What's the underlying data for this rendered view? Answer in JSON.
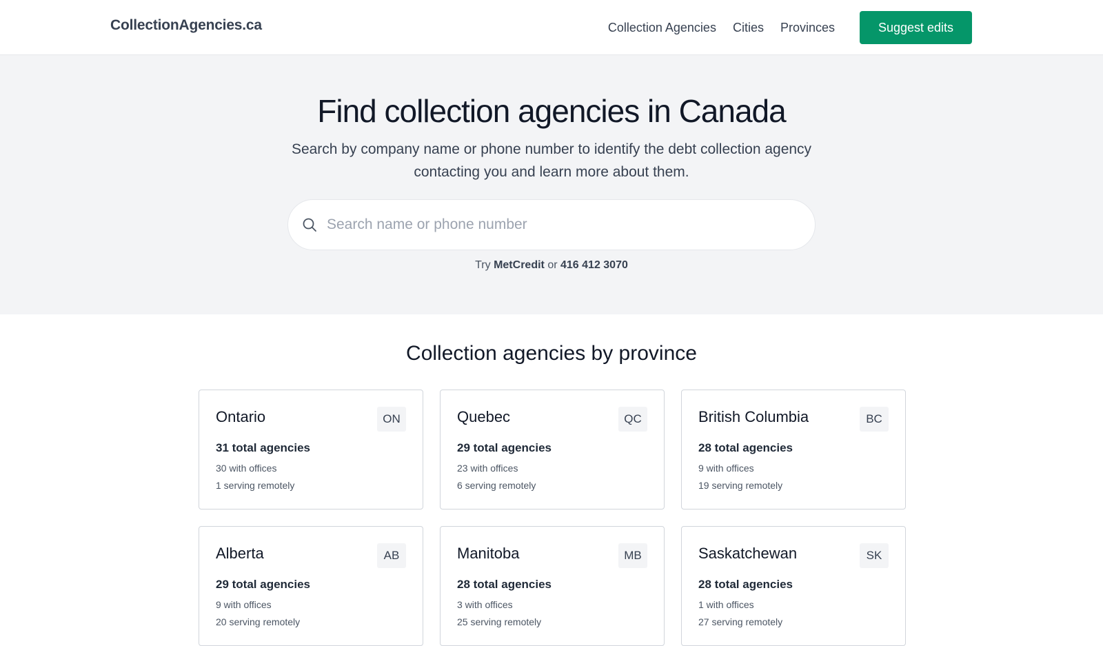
{
  "header": {
    "brand": "CollectionAgencies.ca",
    "nav": [
      "Collection Agencies",
      "Cities",
      "Provinces"
    ],
    "suggest_button": "Suggest edits"
  },
  "hero": {
    "title": "Find collection agencies in Canada",
    "subtitle": "Search by company name or phone number to identify the debt collection agency contacting you and learn more about them.",
    "search": {
      "placeholder": "Search name or phone number",
      "value": ""
    },
    "try": {
      "prefix": "Try",
      "example_name": "MetCredit",
      "connector": "or",
      "example_phone": "416 412 3070"
    }
  },
  "provinces": {
    "title": "Collection agencies by province",
    "cards": [
      {
        "name": "Ontario",
        "code": "ON",
        "total": "31 total agencies",
        "offices": "30 with offices",
        "remote": "1 serving remotely"
      },
      {
        "name": "Quebec",
        "code": "QC",
        "total": "29 total agencies",
        "offices": "23 with offices",
        "remote": "6 serving remotely"
      },
      {
        "name": "British Columbia",
        "code": "BC",
        "total": "28 total agencies",
        "offices": "9 with offices",
        "remote": "19 serving remotely"
      },
      {
        "name": "Alberta",
        "code": "AB",
        "total": "29 total agencies",
        "offices": "9 with offices",
        "remote": "20 serving remotely"
      },
      {
        "name": "Manitoba",
        "code": "MB",
        "total": "28 total agencies",
        "offices": "3 with offices",
        "remote": "25 serving remotely"
      },
      {
        "name": "Saskatchewan",
        "code": "SK",
        "total": "28 total agencies",
        "offices": "1 with offices",
        "remote": "27 serving remotely"
      }
    ]
  },
  "colors": {
    "accent": "#059669",
    "hero_bg": "#f3f4f6"
  }
}
